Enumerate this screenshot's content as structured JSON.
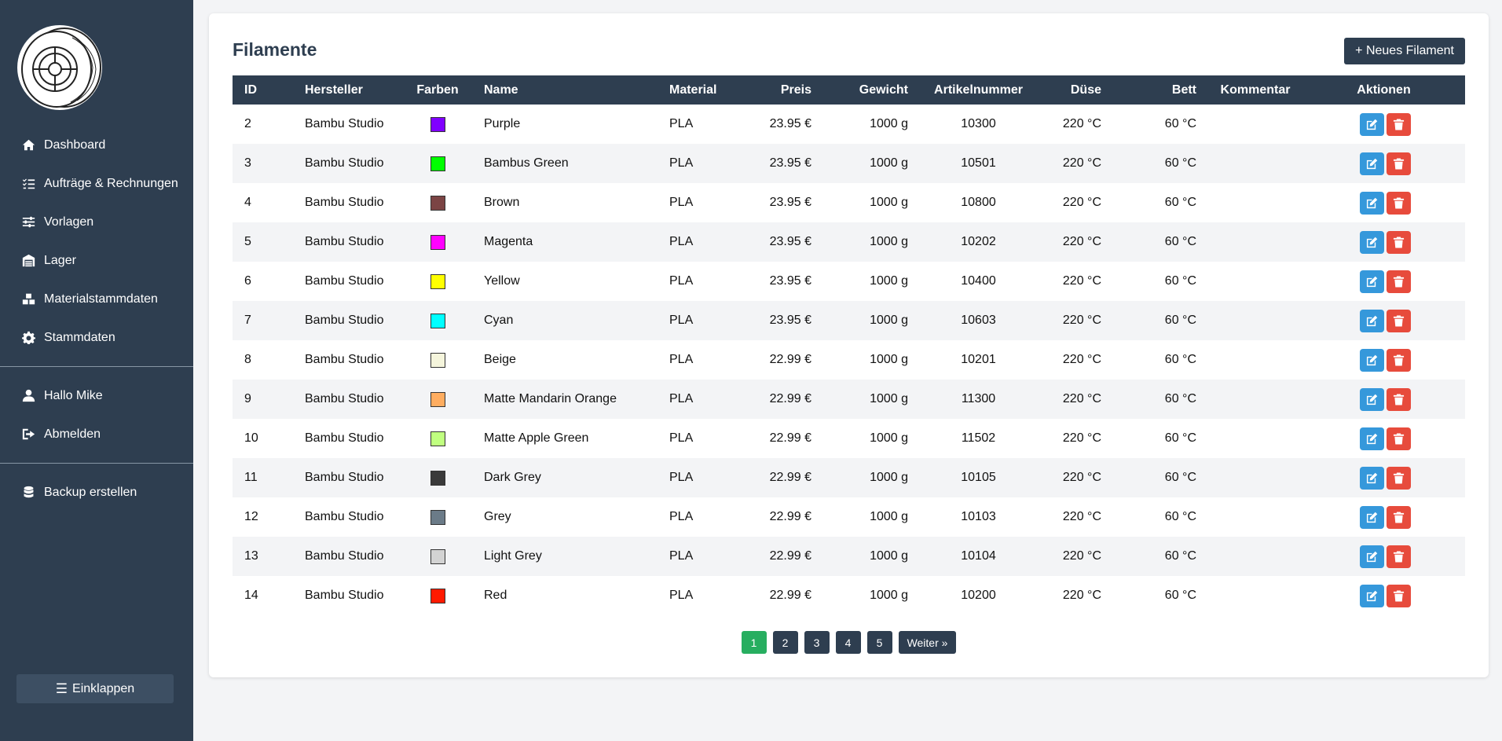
{
  "sidebar": {
    "nav": [
      {
        "label": "Dashboard",
        "icon": "home-icon"
      },
      {
        "label": "Aufträge & Rechnungen",
        "icon": "list-check-icon"
      },
      {
        "label": "Vorlagen",
        "icon": "sliders-icon"
      },
      {
        "label": "Lager",
        "icon": "warehouse-icon"
      },
      {
        "label": "Materialstammdaten",
        "icon": "boxes-icon"
      },
      {
        "label": "Stammdaten",
        "icon": "gear-icon"
      }
    ],
    "user": [
      {
        "label": "Hallo Mike",
        "icon": "user-icon"
      },
      {
        "label": "Abmelden",
        "icon": "logout-icon"
      }
    ],
    "backup": {
      "label": "Backup erstellen",
      "icon": "database-icon"
    },
    "collapse_label": "Einklappen"
  },
  "main": {
    "title": "Filamente",
    "new_button": "+ Neues Filament",
    "columns": [
      "ID",
      "Hersteller",
      "Farben",
      "Name",
      "Material",
      "Preis",
      "Gewicht",
      "Artikelnummer",
      "Düse",
      "Bett",
      "Kommentar",
      "Aktionen"
    ],
    "rows": [
      {
        "id": "2",
        "hersteller": "Bambu Studio",
        "color": "#8000ff",
        "name": "Purple",
        "material": "PLA",
        "preis": "23.95 €",
        "gewicht": "1000 g",
        "artikel": "10300",
        "duese": "220 °C",
        "bett": "60 °C",
        "kommentar": ""
      },
      {
        "id": "3",
        "hersteller": "Bambu Studio",
        "color": "#00ff00",
        "name": "Bambus Green",
        "material": "PLA",
        "preis": "23.95 €",
        "gewicht": "1000 g",
        "artikel": "10501",
        "duese": "220 °C",
        "bett": "60 °C",
        "kommentar": ""
      },
      {
        "id": "4",
        "hersteller": "Bambu Studio",
        "color": "#7b4444",
        "name": "Brown",
        "material": "PLA",
        "preis": "23.95 €",
        "gewicht": "1000 g",
        "artikel": "10800",
        "duese": "220 °C",
        "bett": "60 °C",
        "kommentar": ""
      },
      {
        "id": "5",
        "hersteller": "Bambu Studio",
        "color": "#ff00ff",
        "name": "Magenta",
        "material": "PLA",
        "preis": "23.95 €",
        "gewicht": "1000 g",
        "artikel": "10202",
        "duese": "220 °C",
        "bett": "60 °C",
        "kommentar": ""
      },
      {
        "id": "6",
        "hersteller": "Bambu Studio",
        "color": "#ffff00",
        "name": "Yellow",
        "material": "PLA",
        "preis": "23.95 €",
        "gewicht": "1000 g",
        "artikel": "10400",
        "duese": "220 °C",
        "bett": "60 °C",
        "kommentar": ""
      },
      {
        "id": "7",
        "hersteller": "Bambu Studio",
        "color": "#00ffff",
        "name": "Cyan",
        "material": "PLA",
        "preis": "23.95 €",
        "gewicht": "1000 g",
        "artikel": "10603",
        "duese": "220 °C",
        "bett": "60 °C",
        "kommentar": ""
      },
      {
        "id": "8",
        "hersteller": "Bambu Studio",
        "color": "#f5f5dc",
        "name": "Beige",
        "material": "PLA",
        "preis": "22.99 €",
        "gewicht": "1000 g",
        "artikel": "10201",
        "duese": "220 °C",
        "bett": "60 °C",
        "kommentar": ""
      },
      {
        "id": "9",
        "hersteller": "Bambu Studio",
        "color": "#ffad60",
        "name": "Matte Mandarin Orange",
        "material": "PLA",
        "preis": "22.99 €",
        "gewicht": "1000 g",
        "artikel": "11300",
        "duese": "220 °C",
        "bett": "60 °C",
        "kommentar": ""
      },
      {
        "id": "10",
        "hersteller": "Bambu Studio",
        "color": "#c0ff80",
        "name": "Matte Apple Green",
        "material": "PLA",
        "preis": "22.99 €",
        "gewicht": "1000 g",
        "artikel": "11502",
        "duese": "220 °C",
        "bett": "60 °C",
        "kommentar": ""
      },
      {
        "id": "11",
        "hersteller": "Bambu Studio",
        "color": "#3a3a3a",
        "name": "Dark Grey",
        "material": "PLA",
        "preis": "22.99 €",
        "gewicht": "1000 g",
        "artikel": "10105",
        "duese": "220 °C",
        "bett": "60 °C",
        "kommentar": ""
      },
      {
        "id": "12",
        "hersteller": "Bambu Studio",
        "color": "#6b7b88",
        "name": "Grey",
        "material": "PLA",
        "preis": "22.99 €",
        "gewicht": "1000 g",
        "artikel": "10103",
        "duese": "220 °C",
        "bett": "60 °C",
        "kommentar": ""
      },
      {
        "id": "13",
        "hersteller": "Bambu Studio",
        "color": "#d3d3d3",
        "name": "Light Grey",
        "material": "PLA",
        "preis": "22.99 €",
        "gewicht": "1000 g",
        "artikel": "10104",
        "duese": "220 °C",
        "bett": "60 °C",
        "kommentar": ""
      },
      {
        "id": "14",
        "hersteller": "Bambu Studio",
        "color": "#ff1a00",
        "name": "Red",
        "material": "PLA",
        "preis": "22.99 €",
        "gewicht": "1000 g",
        "artikel": "10200",
        "duese": "220 °C",
        "bett": "60 °C",
        "kommentar": ""
      }
    ],
    "pagination": {
      "pages": [
        "1",
        "2",
        "3",
        "4",
        "5"
      ],
      "current": "1",
      "next_label": "Weiter »"
    }
  },
  "colors": {
    "sidebar_bg": "#2e3e50",
    "edit": "#3598db",
    "delete": "#e74b3c",
    "active_page": "#27ae60"
  }
}
